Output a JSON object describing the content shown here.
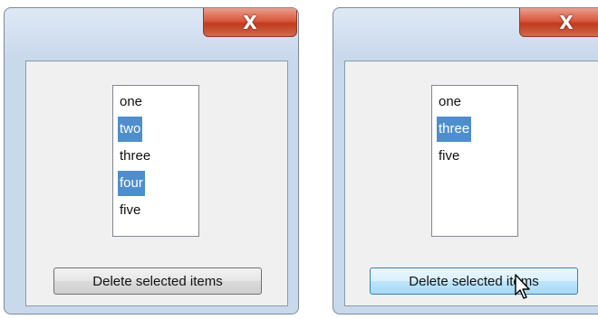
{
  "windows": [
    {
      "close_label": "X",
      "list_items": [
        {
          "label": "one",
          "selected": false
        },
        {
          "label": "two",
          "selected": true
        },
        {
          "label": "three",
          "selected": false
        },
        {
          "label": "four",
          "selected": true
        },
        {
          "label": "five",
          "selected": false
        }
      ],
      "delete_button_label": "Delete selected items",
      "delete_button_state": "normal"
    },
    {
      "close_label": "X",
      "list_items": [
        {
          "label": "one",
          "selected": false
        },
        {
          "label": "three",
          "selected": true
        },
        {
          "label": "five",
          "selected": false
        }
      ],
      "delete_button_label": "Delete selected items",
      "delete_button_state": "hover"
    }
  ],
  "colors": {
    "selection": "#4f8ecc",
    "close_button": "#c9462b",
    "hover_button": "#bee6fd"
  },
  "icons": [
    "close-icon",
    "mouse-pointer-icon"
  ]
}
